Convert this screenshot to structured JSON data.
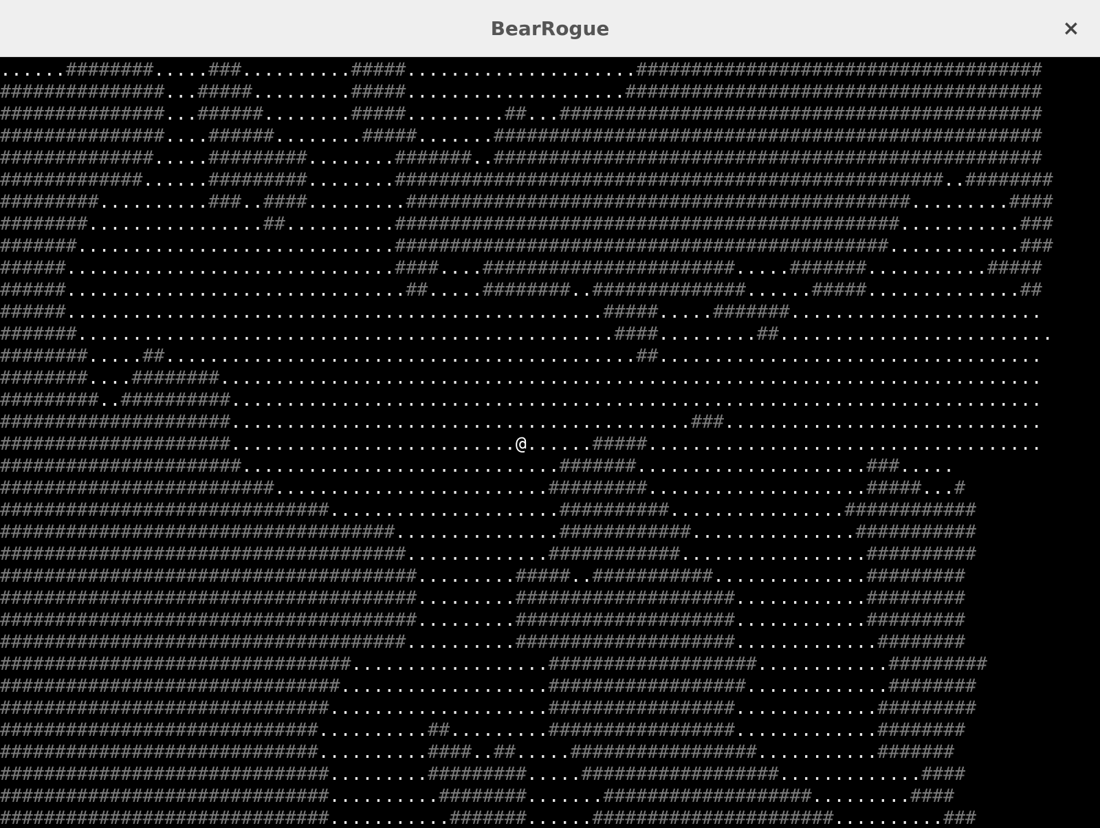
{
  "window": {
    "title": "BearRogue",
    "close_glyph": "×"
  },
  "legend": {
    "wall": "#",
    "floor": ".",
    "player": "@"
  },
  "colors": {
    "titlebar_bg": "#efefef",
    "title_text": "#555555",
    "map_bg": "#000000",
    "wall": "#7a7a7a",
    "floor": "#e8e8e8",
    "player": "#ffffff"
  },
  "map": {
    "rows": [
      "......########.....###..........#####.....................#####################################",
      "###############...#####.........#####....................######################################",
      "###############...######........#####.........##...############################################",
      "###############....######........#####.......##################################################",
      "##############.....#########........#######..##################################################",
      "#############......#########........##################################################..########",
      "#########..........###..####.........##############################################.........####",
      "########................##..........##############################################...........###",
      "#######.............................#############################################............###",
      "######..............................####....#######################.....#######...........#####",
      "######...............................##.....########..##############......#####..............##",
      "######.................................................#####.....#######.......................",
      "#######.................................................####.........##.........................",
      "########.....##...........................................##...................................",
      "########....########...........................................................................",
      "#########..##########..........................................................................",
      "#####################..........................................###.............................",
      "#####################..........................@......#####....................................",
      "######################.............................#######.....................###.....",
      "#########################.........................#########....................#####...#",
      "##############################.....................##########................############",
      "####################################...............############...............###########",
      "#####################################.............############.................##########",
      "######################################.........#####..###########..............#########",
      "######################################.........####################............#########",
      "######################################.........####################............#########",
      "#####################################..........####################.............########",
      "################################..................###################............#########",
      "###############################...................##################.............########",
      "##############################....................#################.............#########",
      "#############################..........##.........#################.............########",
      "#############################..........####..##.....#################...........#######",
      "##############################.........#########.....##################.............####",
      "##############################..........########.......###################.........####",
      "##############################...........#######......######################..........###"
    ]
  }
}
